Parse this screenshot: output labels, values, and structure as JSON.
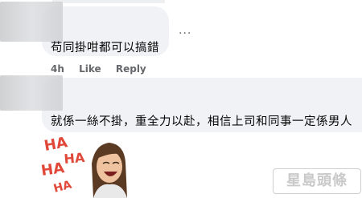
{
  "comments": [
    {
      "text": "苟同掛咁都可以搞錯",
      "more_label": "...",
      "time": "4h",
      "like_label": "Like",
      "reply_label": "Reply"
    },
    {
      "text": "就係一絲不掛，重全力以赴，相信上司和同事一定係男人"
    }
  ],
  "sticker": {
    "caption": "HA HA HA HA",
    "colors": {
      "letters": "#e0483a",
      "hair": "#5a3a22",
      "skin": "#f0c3a0",
      "shirt": "#e9e9ea"
    }
  },
  "watermark": {
    "text": "星島頭條"
  }
}
